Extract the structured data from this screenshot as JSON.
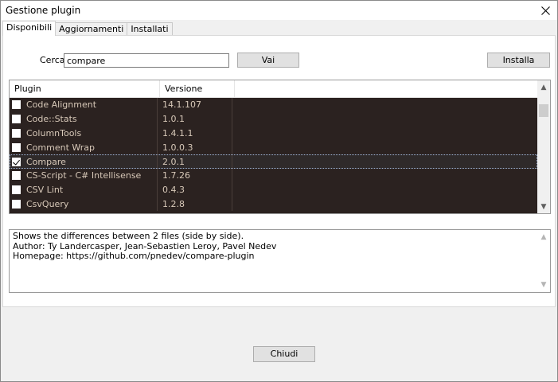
{
  "window": {
    "title": "Gestione plugin"
  },
  "tabs": [
    {
      "label": "Disponibili",
      "active": true
    },
    {
      "label": "Aggiornamenti",
      "active": false
    },
    {
      "label": "Installati",
      "active": false
    }
  ],
  "search": {
    "label": "Cerca:",
    "value": "compare",
    "go_label": "Vai"
  },
  "install_label": "Installa",
  "list": {
    "columns": [
      "Plugin",
      "Versione"
    ],
    "rows": [
      {
        "name": "Code Alignment",
        "version": "14.1.107",
        "checked": false
      },
      {
        "name": "Code::Stats",
        "version": "1.0.1",
        "checked": false
      },
      {
        "name": "ColumnTools",
        "version": "1.4.1.1",
        "checked": false
      },
      {
        "name": "Comment Wrap",
        "version": "1.0.0.3",
        "checked": false
      },
      {
        "name": "Compare",
        "version": "2.0.1",
        "checked": true
      },
      {
        "name": "CS-Script - C# Intellisense",
        "version": "1.7.26",
        "checked": false
      },
      {
        "name": "CSV Lint",
        "version": "0.4.3",
        "checked": false
      },
      {
        "name": "CsvQuery",
        "version": "1.2.8",
        "checked": false
      }
    ]
  },
  "description": {
    "lines": [
      "Shows the differences between 2 files (side by side).",
      "Author: Ty Landercasper, Jean-Sebastien Leroy, Pavel Nedev",
      "Homepage: https://github.com/pnedev/compare-plugin"
    ]
  },
  "close_label": "Chiudi",
  "colors": {
    "list_background": "#2b2220",
    "list_text": "#d7c8b8"
  }
}
